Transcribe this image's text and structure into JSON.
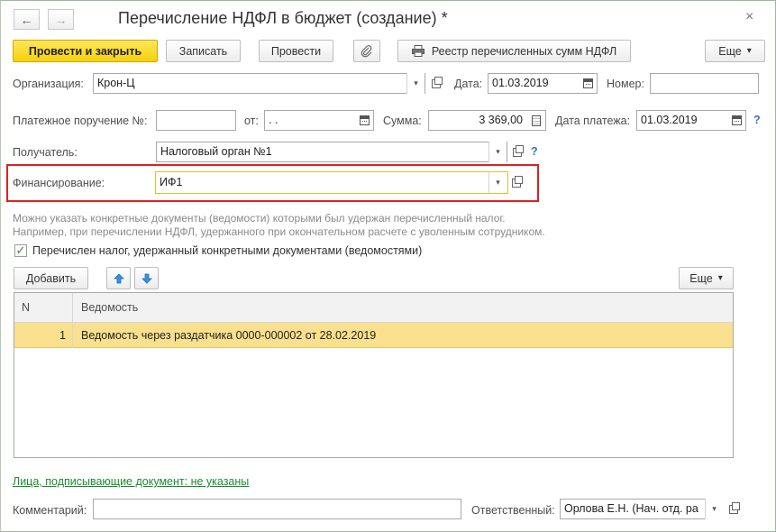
{
  "window": {
    "title": "Перечисление НДФЛ в бюджет (создание) *",
    "back_icon": "←",
    "forward_icon": "→",
    "close_icon": "×"
  },
  "toolbar": {
    "post_close": "Провести и закрыть",
    "save": "Записать",
    "post": "Провести",
    "register": "Реестр перечисленных сумм НДФЛ",
    "more": "Еще",
    "more_arrow": "▾",
    "clip_icon": "⌀"
  },
  "form": {
    "org_label": "Организация:",
    "org_value": "Крон-Ц",
    "date_label": "Дата:",
    "date_value": "01.03.2019",
    "number_label": "Номер:",
    "number_value": "",
    "payment_order_label": "Платежное поручение №:",
    "payment_order_value": "",
    "from_label": "от:",
    "from_value": " .  .",
    "sum_label": "Сумма:",
    "sum_value": "3 369,00",
    "pay_date_label": "Дата платежа:",
    "pay_date_value": "01.03.2019",
    "recipient_label": "Получатель:",
    "recipient_value": "Налоговый орган №1",
    "financing_label": "Финансирование:",
    "financing_value": "ИФ1",
    "help_mark": "?",
    "dropdown_arrow": "▾"
  },
  "hint": {
    "line1": "Можно указать конкретные документы (ведомости) которыми был удержан перечисленный налог.",
    "line2": "Например, при перечислении НДФЛ, удержанного при окончательном расчете с уволенным сотрудником."
  },
  "checkbox": {
    "checked_mark": "✓",
    "label": "Перечислен налог, удержанный конкретными документами (ведомостями)"
  },
  "table_toolbar": {
    "add": "Добавить",
    "more": "Еще",
    "more_arrow": "▾"
  },
  "table": {
    "columns": [
      "N",
      "Ведомость"
    ],
    "rows": [
      {
        "n": "1",
        "doc": "Ведомость через раздатчика 0000-000002 от 28.02.2019"
      }
    ]
  },
  "footer": {
    "signers_link": "Лица, подписывающие документ: не указаны",
    "comment_label": "Комментарий:",
    "comment_value": "",
    "responsible_label": "Ответственный:",
    "responsible_value": "Орлова Е.Н. (Нач. отд. ра"
  },
  "colors": {
    "primary_button": "#f5d20c",
    "selected_row": "#f9e08e",
    "highlight_border": "#e0201f",
    "link_green": "#1b8c2e",
    "help_blue": "#2f76c2"
  }
}
